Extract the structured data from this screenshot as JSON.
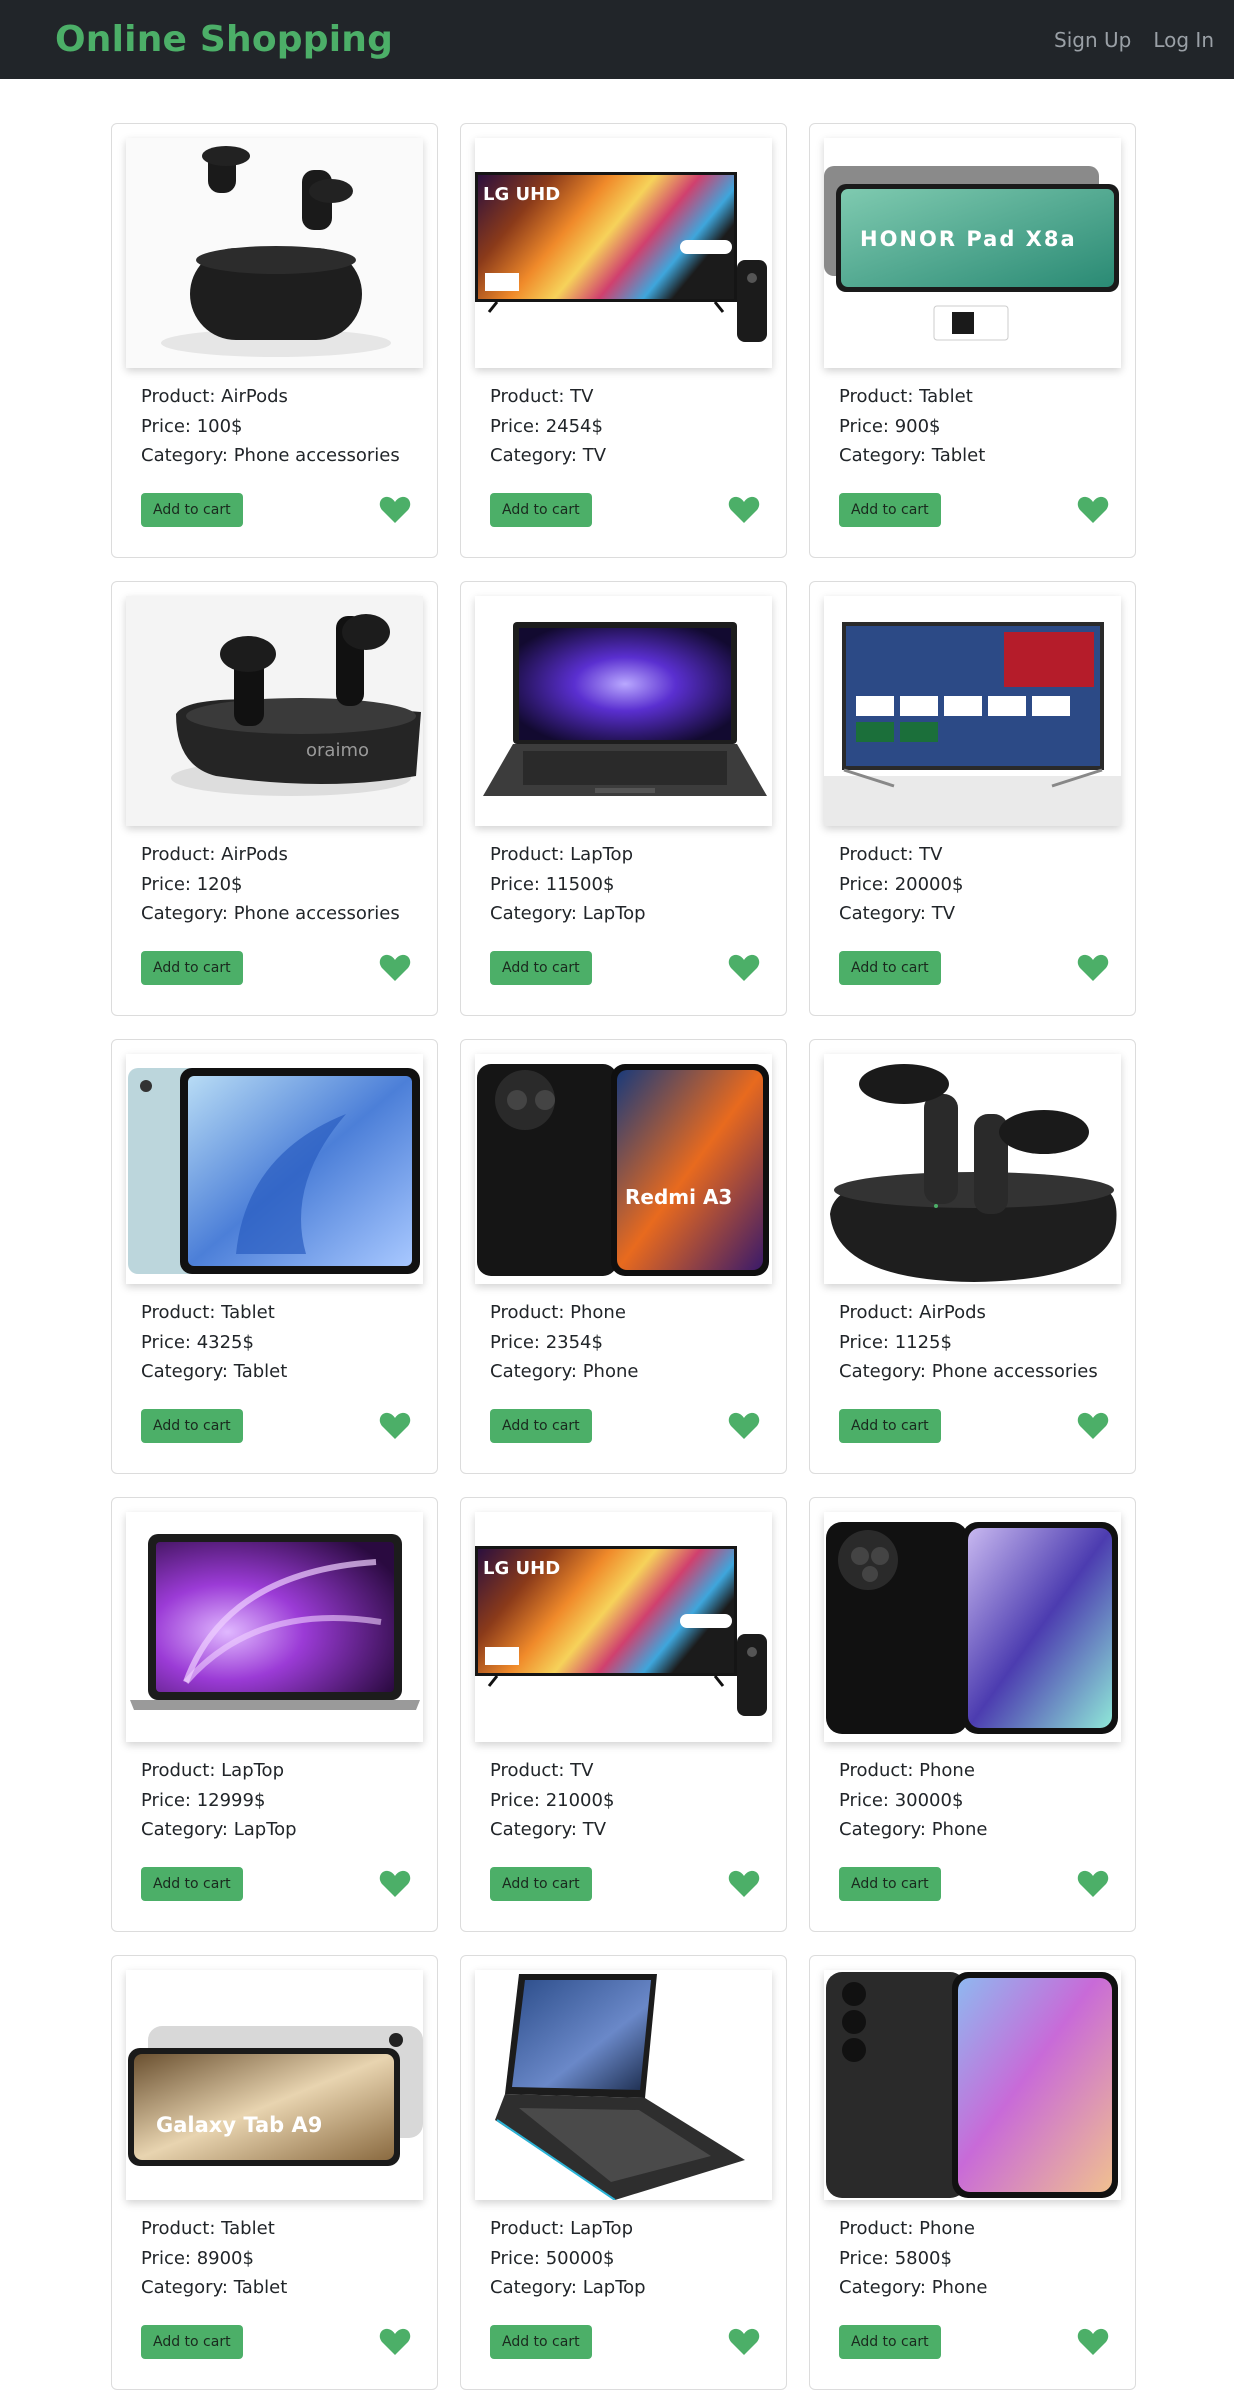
{
  "header": {
    "brand": "Online Shopping",
    "signup": "Sign Up",
    "login": "Log In"
  },
  "colors": {
    "accent": "#4caf68",
    "navbar": "#212529"
  },
  "labels": {
    "product": "Product: ",
    "price": "Price: ",
    "category": "Category: ",
    "add_to_cart": "Add to cart"
  },
  "products": [
    {
      "name": "AirPods",
      "price": "100$",
      "category": "Phone accessories",
      "image": "earbuds-case"
    },
    {
      "name": "TV",
      "price": "2454$",
      "category": "TV",
      "image": "lg-uhd-tv",
      "image_text": "LG UHD"
    },
    {
      "name": "Tablet",
      "price": "900$",
      "category": "Tablet",
      "image": "honor-tablet",
      "image_text": "HONOR Pad X8a"
    },
    {
      "name": "AirPods",
      "price": "120$",
      "category": "Phone accessories",
      "image": "oraimo-earbuds",
      "image_text": "oraimo"
    },
    {
      "name": "LapTop",
      "price": "11500$",
      "category": "LapTop",
      "image": "gaming-laptop"
    },
    {
      "name": "TV",
      "price": "20000$",
      "category": "TV",
      "image": "smart-tv"
    },
    {
      "name": "Tablet",
      "price": "4325$",
      "category": "Tablet",
      "image": "ipad-air"
    },
    {
      "name": "Phone",
      "price": "2354$",
      "category": "Phone",
      "image": "redmi-a3",
      "image_text": "Redmi A3"
    },
    {
      "name": "AirPods",
      "price": "1125$",
      "category": "Phone accessories",
      "image": "earbuds-open-case"
    },
    {
      "name": "LapTop",
      "price": "12999$",
      "category": "LapTop",
      "image": "macbook"
    },
    {
      "name": "TV",
      "price": "21000$",
      "category": "TV",
      "image": "lg-uhd-tv",
      "image_text": "LG UHD"
    },
    {
      "name": "Phone",
      "price": "30000$",
      "category": "Phone",
      "image": "black-phone"
    },
    {
      "name": "Tablet",
      "price": "8900$",
      "category": "Tablet",
      "image": "galaxy-tab-a9",
      "image_text": "Galaxy Tab A9"
    },
    {
      "name": "LapTop",
      "price": "50000$",
      "category": "LapTop",
      "image": "ideapad-laptop"
    },
    {
      "name": "Phone",
      "price": "5800$",
      "category": "Phone",
      "image": "samsung-phone"
    }
  ]
}
